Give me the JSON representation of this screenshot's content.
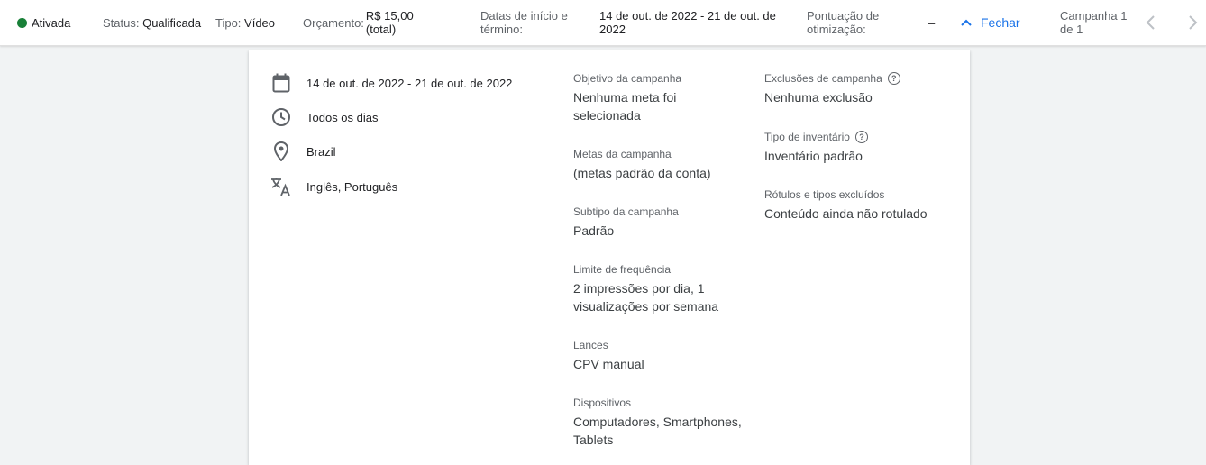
{
  "topbar": {
    "status_active": "Ativada",
    "status_label": "Status:",
    "status_value": "Qualificada",
    "type_label": "Tipo:",
    "type_value": "Vídeo",
    "budget_label": "Orçamento:",
    "budget_value_line1": "R$ 15,00",
    "budget_value_line2": "(total)",
    "dates_label_line1": "Datas de início e",
    "dates_label_line2": "término:",
    "dates_value_line1": "14 de out. de 2022 - 21 de out. de",
    "dates_value_line2": "2022",
    "optim_label_line1": "Pontuação de",
    "optim_label_line2": "otimização:",
    "optim_value": "–",
    "close_label": "Fechar",
    "campaign_count_line1": "Campanha 1",
    "campaign_count_line2": "de 1",
    "status_color": "#188038",
    "accent_color": "#1a73e8"
  },
  "summary": {
    "dates": "14 de out. de 2022 - 21 de out. de 2022",
    "schedule": "Todos os dias",
    "location": "Brazil",
    "languages": "Inglês, Português"
  },
  "middle_fields": [
    {
      "label": "Objetivo da campanha",
      "value_line1": "Nenhuma meta foi",
      "value_line2": "selecionada"
    },
    {
      "label": "Metas da campanha",
      "value_line1": "(metas padrão da conta)"
    },
    {
      "label": "Subtipo da campanha",
      "value_line1": "Padrão"
    },
    {
      "label": "Limite de frequência",
      "value_line1": "2 impressões por dia, 1",
      "value_line2": "visualizações por semana"
    },
    {
      "label": "Lances",
      "value_line1": "CPV manual"
    },
    {
      "label": "Dispositivos",
      "value_line1": "Computadores, Smartphones,",
      "value_line2": "Tablets"
    }
  ],
  "right_fields": [
    {
      "label": "Exclusões de campanha",
      "value": "Nenhuma exclusão"
    },
    {
      "label": "Tipo de inventário",
      "value": "Inventário padrão"
    },
    {
      "label": "Rótulos e tipos excluídos",
      "value": "Conteúdo ainda não rotulado"
    }
  ],
  "icons": {
    "calendar": "calendar-icon",
    "clock": "clock-icon",
    "location": "location-pin-icon",
    "language": "translate-icon",
    "help": "help-icon",
    "chevron_up": "chevron-up-icon",
    "prev": "chevron-left-icon",
    "next": "chevron-right-icon"
  }
}
